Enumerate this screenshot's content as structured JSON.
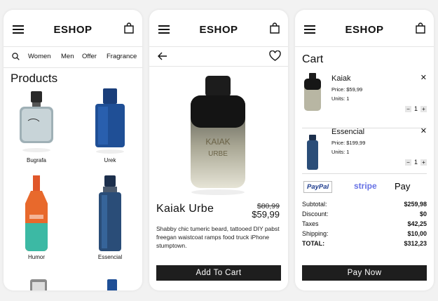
{
  "shop_list": {
    "brand": "ESHOP",
    "categories": [
      "Women",
      "Men",
      "Offer",
      "Fragrance"
    ],
    "title": "Products",
    "products": [
      {
        "name": "Bugrafa"
      },
      {
        "name": "Urek"
      },
      {
        "name": "Humor"
      },
      {
        "name": "Essencial"
      }
    ]
  },
  "product_detail": {
    "brand": "ESHOP",
    "name": "Kaiak Urbe",
    "old_price": "$80,99",
    "price": "$59,99",
    "description": "Shabby chic tumeric beard, tattooed DIY pabst freegan waistcoat ramps food truck iPhone stumptown.",
    "bottle_label_1": "KAIAK",
    "bottle_label_2": "URBE",
    "add_button": "Add To Cart"
  },
  "cart": {
    "brand": "ESHOP",
    "title": "Cart",
    "items": [
      {
        "name": "Kaiak",
        "price": "Price: $59,99",
        "units": "Units: 1",
        "qty": "1"
      },
      {
        "name": "Essencial",
        "price": "Price: $199,99",
        "units": "Units: 1",
        "qty": "1"
      }
    ],
    "payment": {
      "paypal": "PayPal",
      "stripe": "stripe",
      "applepay": "Pay"
    },
    "summary": [
      {
        "label": "Subtotal:",
        "value": "$259,98"
      },
      {
        "label": "Discount:",
        "value": "$0"
      },
      {
        "label": "Taxes",
        "value": "$42,25"
      },
      {
        "label": "Shipping:",
        "value": "$10,00"
      },
      {
        "label": "TOTAL:",
        "value": "$312,23"
      }
    ],
    "pay_button": "Pay Now"
  },
  "colors": {
    "dark_button": "#1e1e1e",
    "paypal": "#1d3b8c",
    "stripe": "#6772e5"
  }
}
